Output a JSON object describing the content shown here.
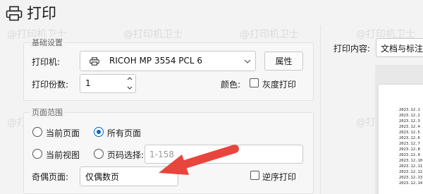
{
  "title": "打印",
  "basic_settings": {
    "legend": "基础设置",
    "printer_label": "打印机:",
    "printer_value": "RICOH MP 3554 PCL 6",
    "properties_button": "属性",
    "copies_label": "打印份数:",
    "copies_value": "1",
    "color_label": "颜色:",
    "grayscale_label": "灰度打印",
    "grayscale_checked": false
  },
  "page_range": {
    "legend": "页面范围",
    "current_page_label": "当前页面",
    "all_pages_label": "所有页面",
    "current_view_label": "当前视图",
    "page_select_label": "页码选择:",
    "page_select_placeholder": "1-158",
    "odd_even_label": "奇偶页面:",
    "odd_even_value": "仅偶数页",
    "reverse_label": "逆序打印",
    "selected": "all_pages",
    "reverse_checked": false
  },
  "print_content": {
    "label": "打印内容:",
    "value": "文档与标注"
  },
  "preview": {
    "lines": [
      "2023.12.1",
      "2023.12.2",
      "2023.12.3",
      "2023.12.4",
      "2023.12.5",
      "2023.12.6",
      "2023.12.7",
      "2023.12.8",
      "2023.12.9",
      "2023.12.10",
      "2023.12.11",
      "2023.12.12",
      "2023.12.13",
      "2023.12.14"
    ]
  },
  "watermark": "@打印机卫士",
  "colors": {
    "accent": "#0067c0",
    "arrow": "#e8453c"
  }
}
